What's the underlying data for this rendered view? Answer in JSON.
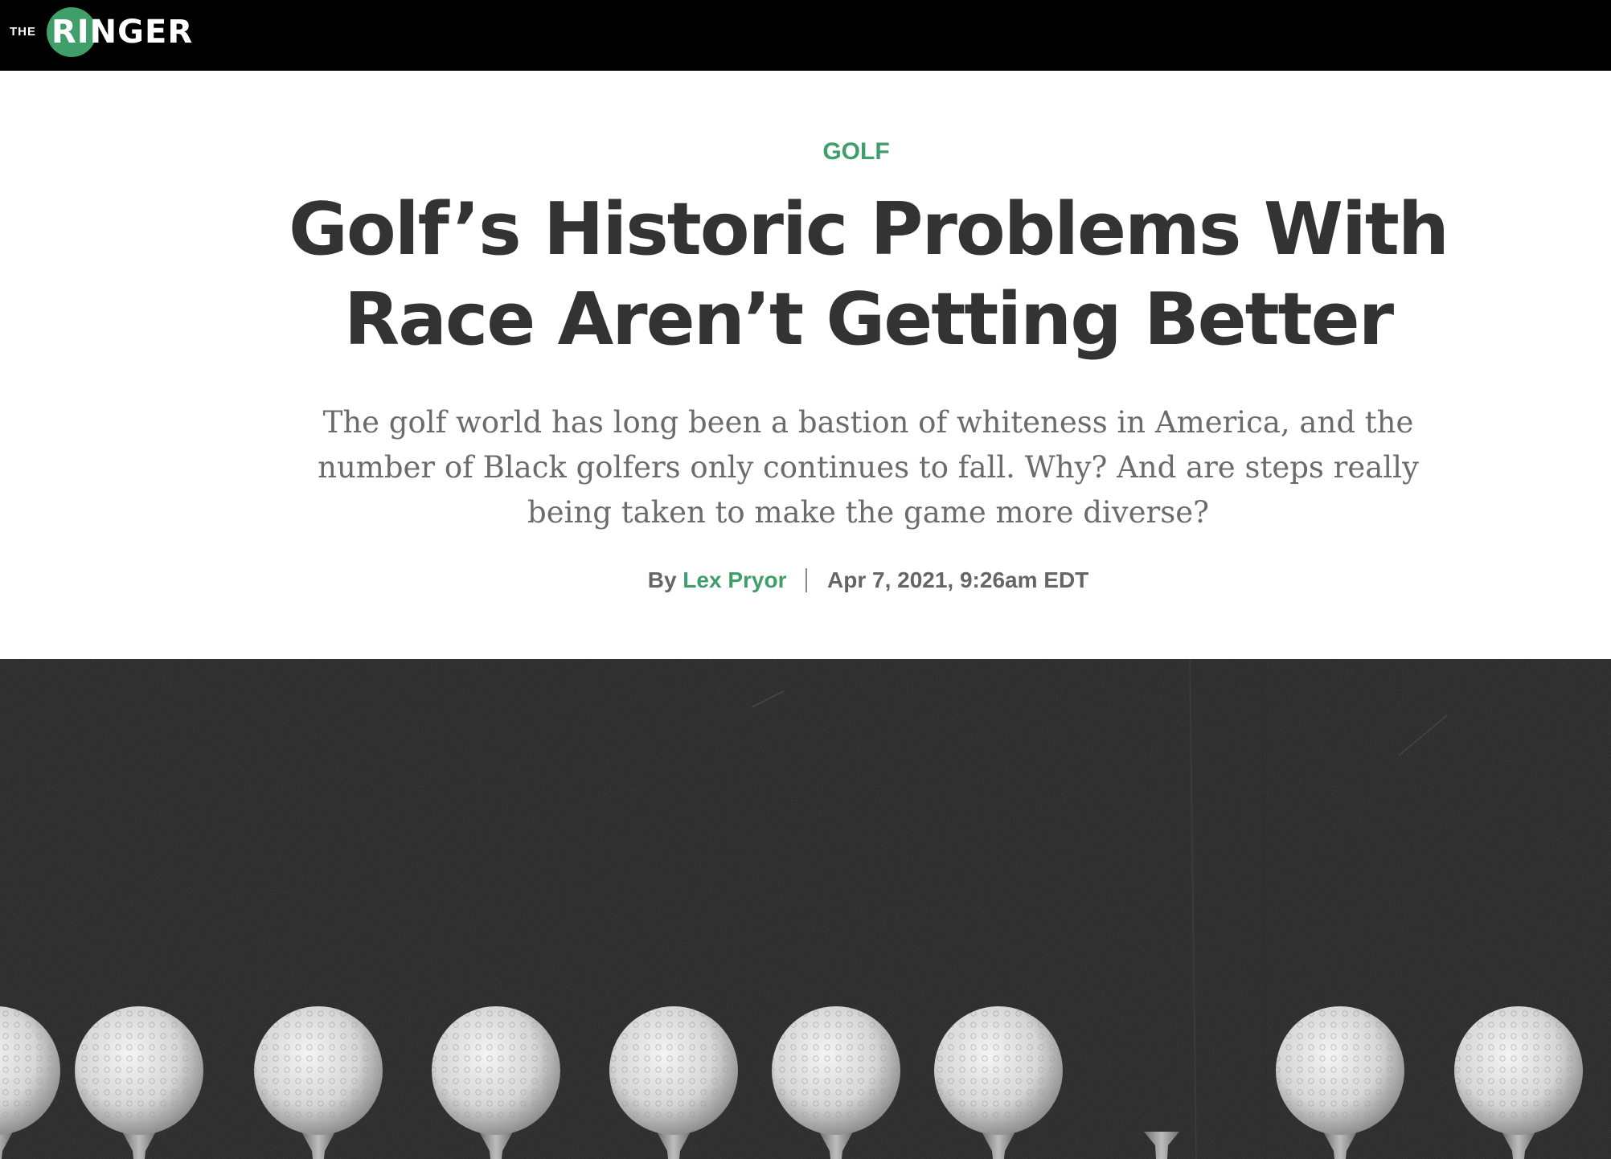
{
  "site": {
    "logo_prefix": "THE",
    "logo_word": "RINGER",
    "brand_color": "#3f9e69"
  },
  "article": {
    "category": "GOLF",
    "headline": "Golf’s Historic Problems With Race Aren’t Getting Better",
    "dek": "The golf world has long been a bastion of whiteness in America, and the number of Black golfers only continues to fall. Why? And are steps really being taken to make the game more diverse?",
    "byline_prefix": "By",
    "author": "Lex Pryor",
    "timestamp": "Apr 7, 2021, 9:26am EDT"
  },
  "hero": {
    "description_icon": "golf-balls-on-tees-image",
    "background_color": "#232323"
  }
}
